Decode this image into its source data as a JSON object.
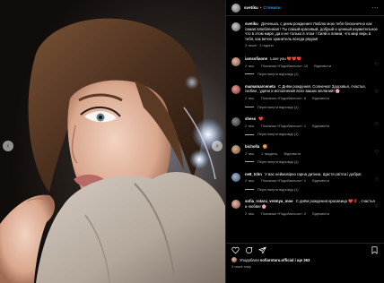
{
  "post": {
    "author": "svetiku",
    "separator": "•",
    "follow_label": "Стежити",
    "more_glyph": "···"
  },
  "caption": {
    "user": "svetiku",
    "text": "Доченька, с днем рождения! Люблю мою тебя бесконечно как самая влюбленная ! Ты самый красивый, добрый и ценный изумительное что в этом мире, да и не только в этом ! Сияй и помни, что мир верь в тебя, как вечно хранитель всегда рядом!",
    "time": "3 тижні · 3 години"
  },
  "comments": [
    {
      "user": "iamsofiaone",
      "text": "Love you ❤️❤️❤️",
      "time": "2 тиж.",
      "likes": "Позначки «Подобається»: 10",
      "reply": "Відповісти",
      "view_replies": "Переглянути відповіді (1)"
    },
    {
      "user": "mamamarceneta",
      "text": "С Днём рождения, Солнечко! Здоровья, счастья, любви , удачи и исполнения всех ваших желаний! 🌸",
      "time": "2 тиж.",
      "likes": "Позначки «Подобається»: 8",
      "reply": "Відповісти",
      "view_replies": "Переглянути відповіді (1)"
    },
    {
      "user": "shess",
      "text": "❤️",
      "time": "2 тиж.",
      "likes": "Позначки «Подобається»: 1",
      "reply": "Відповісти",
      "view_replies": "Переглянути відповіді (1)"
    },
    {
      "user": "bicholla",
      "text": "🥰",
      "time": "2 тиж.",
      "likes": "1 тиждень",
      "reply": "Відповісти",
      "view_replies": "Переглянути відповіді (1)"
    },
    {
      "user": "ne8_tchn",
      "text": "У вас неймовірно гарна дитина. Щастя,світла і добра!",
      "time": "2 тиж.",
      "likes": "Позначки «Подобається»: 1",
      "reply": "Відповісти",
      "view_replies": "Переглянути відповіді (1)"
    },
    {
      "user": "sofia_rotaru_vremya_moe",
      "text": "С днём рождения красавица ❤️🌹 , счастья и любви! 🌸",
      "time": "2 тиж.",
      "likes": "Позначки «Подобається»: 2",
      "reply": "Відповісти",
      "view_replies": ""
    }
  ],
  "footer": {
    "liked_by_prefix": "Уподобали",
    "liked_by_user": "sofiarotaru.official",
    "liked_by_suffix": "і ще 363",
    "date": "3 тижні тому"
  },
  "colors": {
    "background": "#000000",
    "link": "#0095f6",
    "heart": "#ed4956"
  },
  "icons": [
    "heart-icon",
    "comment-icon",
    "share-icon",
    "save-icon",
    "more-icon",
    "chevron-left-icon",
    "chevron-right-icon"
  ]
}
